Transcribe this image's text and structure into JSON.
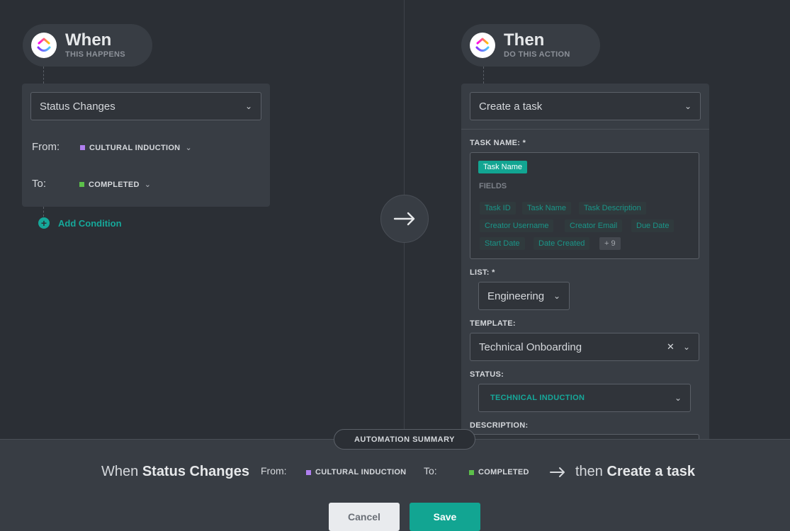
{
  "when": {
    "title": "When",
    "subtitle": "THIS HAPPENS"
  },
  "then": {
    "title": "Then",
    "subtitle": "DO THIS ACTION"
  },
  "trigger": {
    "select_value": "Status Changes",
    "from_label": "From:",
    "from_status": "CULTURAL INDUCTION",
    "from_color": "#b07ff0",
    "to_label": "To:",
    "to_status": "COMPLETED",
    "to_color": "#5cc04a",
    "add_condition": "Add Condition"
  },
  "action": {
    "select_value": "Create a task",
    "task_name_label": "TASK NAME: *",
    "task_name_tag": "Task Name",
    "fields_label": "FIELDS",
    "fields": [
      "Task ID",
      "Task Name",
      "Task Description",
      "Creator Username",
      "Creator Email",
      "Due Date",
      "Start Date",
      "Date Created"
    ],
    "more_fields": "+ 9",
    "list_label": "LIST: *",
    "list_value": "Engineering",
    "template_label": "TEMPLATE:",
    "template_value": "Technical Onboarding",
    "status_label": "STATUS:",
    "status_value": "TECHNICAL INDUCTION",
    "description_label": "DESCRIPTION:"
  },
  "summary": {
    "badge": "AUTOMATION SUMMARY",
    "when_word": "When",
    "trigger": "Status Changes",
    "from_label": "From:",
    "from_status": "CULTURAL INDUCTION",
    "to_label": "To:",
    "to_status": "COMPLETED",
    "then_word": "then",
    "action": "Create a task"
  },
  "buttons": {
    "cancel": "Cancel",
    "save": "Save"
  },
  "colors": {
    "accent": "#12a592",
    "background": "#2b2f35",
    "card": "#383d44"
  }
}
